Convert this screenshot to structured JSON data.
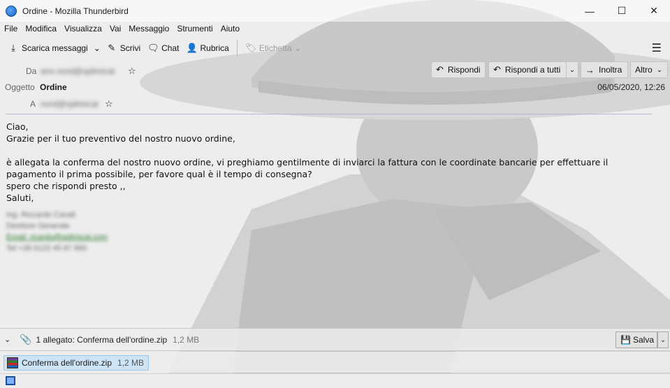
{
  "window": {
    "title": "Ordine - Mozilla Thunderbird",
    "controls": {
      "minimize": "—",
      "maximize": "☐",
      "close": "✕"
    }
  },
  "menubar": {
    "items": [
      "File",
      "Modifica",
      "Visualizza",
      "Vai",
      "Messaggio",
      "Strumenti",
      "Aiuto"
    ]
  },
  "toolbar": {
    "get_messages": "Scarica messaggi",
    "write": "Scrivi",
    "chat": "Chat",
    "address_book": "Rubrica",
    "tag": "Etichetta"
  },
  "header": {
    "from_label": "Da",
    "from_value": "ann.nord@splimicat",
    "subject_label": "Oggetto",
    "subject_value": "Ordine",
    "to_label": "A",
    "to_value": "nord@splimicat",
    "date": "06/05/2020, 12:26",
    "reply": "Rispondi",
    "reply_all": "Rispondi a tutti",
    "forward": "Inoltra",
    "more": "Altro"
  },
  "message": {
    "lines": [
      "Ciao,",
      "Grazie per il tuo preventivo del nostro nuovo ordine,",
      "",
      "è allegata la conferma del nostro nuovo ordine, vi preghiamo gentilmente di inviarci la fattura con le coordinate bancarie per effettuare il",
      "pagamento il prima possibile, per favore qual è il tempo di consegna?",
      "spero che rispondi presto ,,",
      "Saluti,"
    ],
    "signature": [
      "Ing. Riccardo Canali",
      "Direttore Generale",
      "Email: ricardo@splimicat.com",
      "Tel +39 0123 45 67 890"
    ]
  },
  "attachments": {
    "summary": "1 allegato: Conferma dell'ordine.zip",
    "summary_size": "1,2 MB",
    "save": "Salva",
    "items": [
      {
        "name": "Conferma dell'ordine.zip",
        "size": "1,2 MB"
      }
    ]
  },
  "colors": {
    "accent_selection": "#cde4f7",
    "window_bg": "#ececec"
  }
}
